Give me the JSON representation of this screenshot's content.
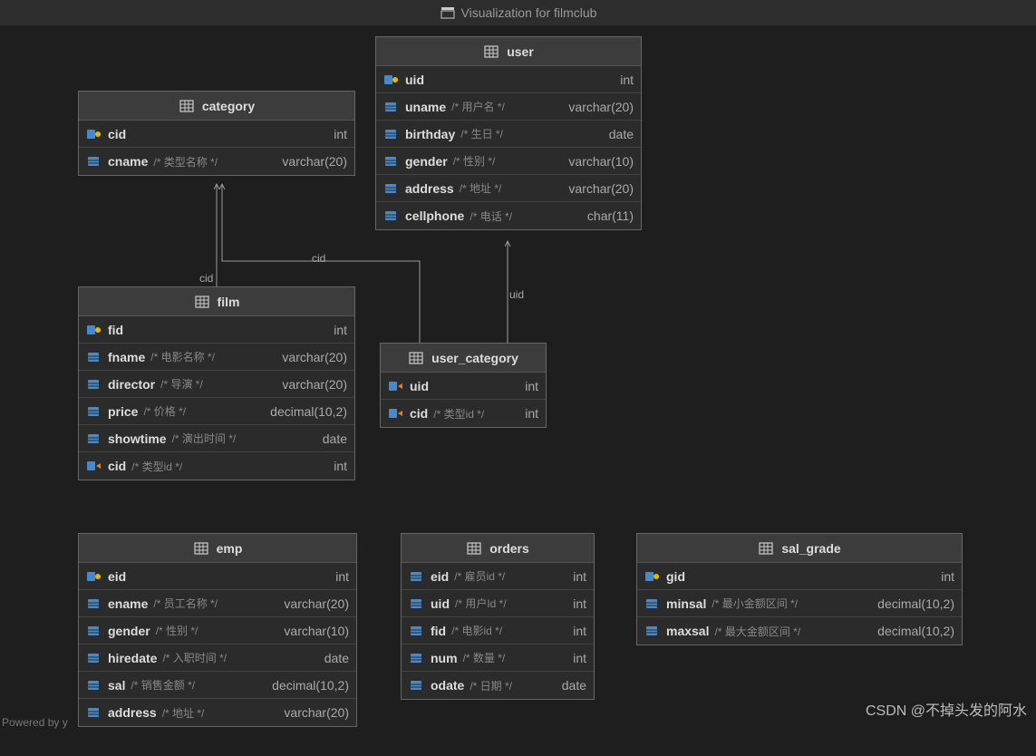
{
  "header": {
    "title": "Visualization for filmclub"
  },
  "watermark": "CSDN @不掉头发的阿水",
  "powered": "Powered by y",
  "labels": {
    "cid1": "cid",
    "cid2": "cid",
    "uid": "uid"
  },
  "tables": {
    "category": {
      "title": "category",
      "rows": [
        {
          "icon": "pk",
          "name": "cid",
          "comment": "",
          "type": "int"
        },
        {
          "icon": "col",
          "name": "cname",
          "comment": "/* 类型名称 */",
          "type": "varchar(20)"
        }
      ]
    },
    "user": {
      "title": "user",
      "rows": [
        {
          "icon": "pk",
          "name": "uid",
          "comment": "",
          "type": "int"
        },
        {
          "icon": "col",
          "name": "uname",
          "comment": "/* 用户名 */",
          "type": "varchar(20)"
        },
        {
          "icon": "col",
          "name": "birthday",
          "comment": "/* 生日 */",
          "type": "date"
        },
        {
          "icon": "col",
          "name": "gender",
          "comment": "/* 性别 */",
          "type": "varchar(10)"
        },
        {
          "icon": "col",
          "name": "address",
          "comment": "/* 地址 */",
          "type": "varchar(20)"
        },
        {
          "icon": "col",
          "name": "cellphone",
          "comment": "/* 电话 */",
          "type": "char(11)"
        }
      ]
    },
    "film": {
      "title": "film",
      "rows": [
        {
          "icon": "pk",
          "name": "fid",
          "comment": "",
          "type": "int"
        },
        {
          "icon": "col",
          "name": "fname",
          "comment": "/* 电影名称 */",
          "type": "varchar(20)"
        },
        {
          "icon": "col",
          "name": "director",
          "comment": "/* 导演 */",
          "type": "varchar(20)"
        },
        {
          "icon": "col",
          "name": "price",
          "comment": "/* 价格 */",
          "type": "decimal(10,2)"
        },
        {
          "icon": "col",
          "name": "showtime",
          "comment": "/* 演出时间 */",
          "type": "date"
        },
        {
          "icon": "fk",
          "name": "cid",
          "comment": "/* 类型id */",
          "type": "int"
        }
      ]
    },
    "user_category": {
      "title": "user_category",
      "rows": [
        {
          "icon": "fk",
          "name": "uid",
          "comment": "",
          "type": "int"
        },
        {
          "icon": "fk",
          "name": "cid",
          "comment": "/* 类型id */",
          "type": "int"
        }
      ]
    },
    "emp": {
      "title": "emp",
      "rows": [
        {
          "icon": "pk",
          "name": "eid",
          "comment": "",
          "type": "int"
        },
        {
          "icon": "col",
          "name": "ename",
          "comment": "/* 员工名称 */",
          "type": "varchar(20)"
        },
        {
          "icon": "col",
          "name": "gender",
          "comment": "/* 性别 */",
          "type": "varchar(10)"
        },
        {
          "icon": "col",
          "name": "hiredate",
          "comment": "/* 入职时间 */",
          "type": "date"
        },
        {
          "icon": "col",
          "name": "sal",
          "comment": "/* 销售金额 */",
          "type": "decimal(10,2)"
        },
        {
          "icon": "col",
          "name": "address",
          "comment": "/* 地址 */",
          "type": "varchar(20)"
        }
      ]
    },
    "orders": {
      "title": "orders",
      "rows": [
        {
          "icon": "col",
          "name": "eid",
          "comment": "/* 雇员id */",
          "type": "int"
        },
        {
          "icon": "col",
          "name": "uid",
          "comment": "/* 用户Id */",
          "type": "int"
        },
        {
          "icon": "col",
          "name": "fid",
          "comment": "/* 电影id */",
          "type": "int"
        },
        {
          "icon": "col",
          "name": "num",
          "comment": "/* 数量 */",
          "type": "int"
        },
        {
          "icon": "col",
          "name": "odate",
          "comment": "/* 日期 */",
          "type": "date"
        }
      ]
    },
    "sal_grade": {
      "title": "sal_grade",
      "rows": [
        {
          "icon": "pk",
          "name": "gid",
          "comment": "",
          "type": "int"
        },
        {
          "icon": "col",
          "name": "minsal",
          "comment": "/* 最小金额区间 */",
          "type": "decimal(10,2)"
        },
        {
          "icon": "col",
          "name": "maxsal",
          "comment": "/* 最大金额区间 */",
          "type": "decimal(10,2)"
        }
      ]
    }
  }
}
